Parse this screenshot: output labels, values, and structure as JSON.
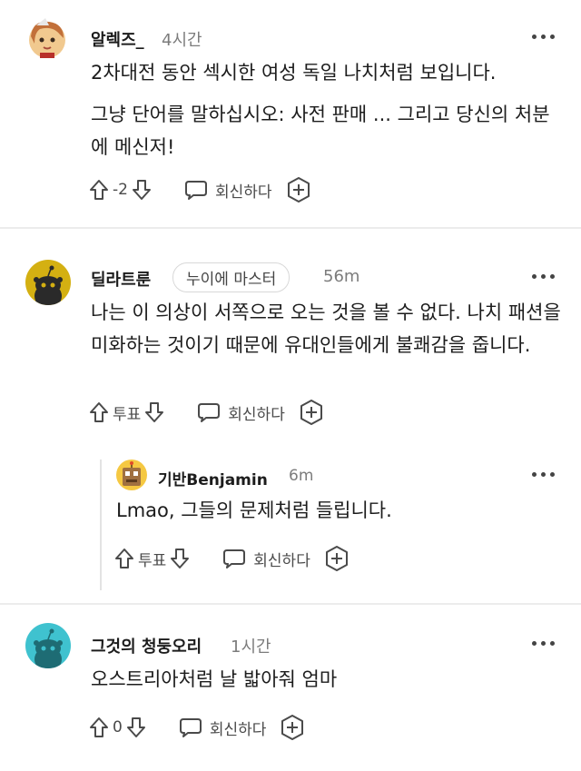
{
  "comments": [
    {
      "username": "알렉즈_",
      "time": "4시간",
      "paragraphs": [
        "2차대전 동안 섹시한 여성 독일 나치처럼 보입니다.",
        "그냥 단어를 말하십시오: 사전 판매 ... 그리고 당신의 처분에 메신저!"
      ],
      "vote_label": "-2",
      "reply_label": "회신하다",
      "avatar_icon": "girl-avatar-icon"
    },
    {
      "username": "딜라트룬",
      "flair": "누이에 마스터",
      "time": "56m",
      "paragraphs": [
        "나는 이 의상이 서쪽으로 오는 것을 볼 수 없다. 나치 패션을 미화하는 것이기 때문에 유대인들에게 불쾌감을 줍니다."
      ],
      "vote_label": "투표",
      "reply_label": "회신하다",
      "avatar_icon": "yellow-snoo-avatar-icon"
    },
    {
      "username": "기반Benjamin",
      "time": "6m",
      "paragraphs": [
        "Lmao, 그들의 문제처럼 들립니다."
      ],
      "vote_label": "투표",
      "reply_label": "회신하다",
      "avatar_icon": "robot-avatar-icon"
    },
    {
      "username": "그것의 청둥오리",
      "time": "1시간",
      "paragraphs": [
        "오스트리아처럼 날 밟아줘 엄마"
      ],
      "vote_label": "0",
      "reply_label": "회신하다",
      "avatar_icon": "teal-snoo-avatar-icon"
    }
  ],
  "colors": {
    "text": "#1c1c1c",
    "muted": "#7c7c7c",
    "divider": "#ececec",
    "snoo_yellow": "#d4b012",
    "snoo_teal": "#3fc2cf"
  }
}
